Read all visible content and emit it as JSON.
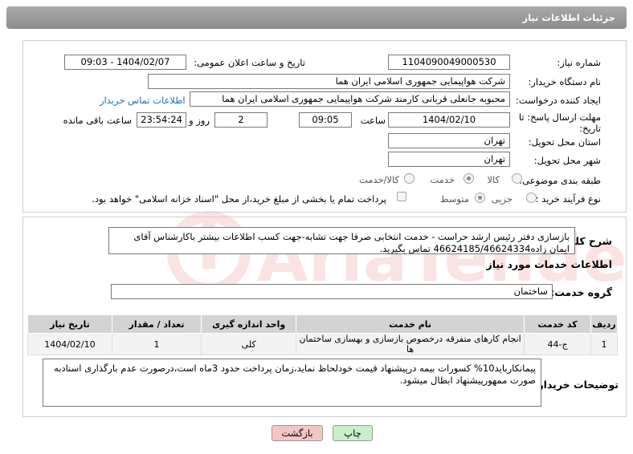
{
  "header": {
    "title": "جزئیات اطلاعات نیاز"
  },
  "form": {
    "need_number_label": "شماره نیاز:",
    "need_number": "1104090049000530",
    "announce_label": "تاریخ و ساعت اعلان عمومی:",
    "announce_value": "1404/02/07 - 09:03",
    "buyer_org_label": "نام دستگاه خریدار:",
    "buyer_org": "شرکت هواپیمایی جمهوری اسلامی ایران هما",
    "creator_label": "ایجاد کننده درخواست:",
    "creator": "محبوبه جانعلی قربانی کارمند شرکت هواپیمایی جمهوری اسلامی ایران هما",
    "contact_link": "اطلاعات تماس خریدار",
    "deadline_label_1": "مهلت ارسال پاسخ: تا",
    "deadline_label_2": "تاریخ:",
    "deadline_date": "1404/02/10",
    "time_label": "ساعت",
    "deadline_time": "09:05",
    "days_value": "2",
    "days_label": "روز و",
    "remaining_time": "23:54:24",
    "remaining_label": "ساعت باقی مانده",
    "province_label": "استان محل تحویل:",
    "province": "تهران",
    "city_label": "شهر محل تحویل:",
    "city": "تهران",
    "category_label": "طبقه بندی موضوعی:",
    "category_options": [
      "کالا",
      "خدمت",
      "کالا/خدمت"
    ],
    "category_selected": "خدمت",
    "process_label": "نوع فرآیند خرید :",
    "process_options": [
      "جزیی",
      "متوسط"
    ],
    "process_selected": "متوسط",
    "payment_note": "پرداخت تمام یا بخشی از مبلغ خرید،از محل \"اسناد خزانه اسلامی\" خواهد بود."
  },
  "description": {
    "label": "شرح کلی نیاز:",
    "text": "بازسازی دفتر رئیس ارشد حراست - خدمت انتخابی صرفا جهت تشابه-جهت کسب اطلاعات بیشتر باکارشناس آقای ایمان زاده46624185/46624334 تماس بگیرید."
  },
  "services": {
    "section_title": "اطلاعات خدمات مورد نیاز",
    "group_label": "گروه خدمت:",
    "group_value": "ساختمان",
    "columns": [
      "ردیف",
      "کد خدمت",
      "نام خدمت",
      "واحد اندازه گیری",
      "تعداد / مقدار",
      "تاریخ نیاز"
    ],
    "rows": [
      [
        "1",
        "ج-44",
        "انجام کارهای متفرقه درخصوص بازسازی و بهسازی ساختمان ها",
        "کلی",
        "1",
        "1404/02/10"
      ]
    ]
  },
  "buyer_notes": {
    "label": "توضیحات خریدار:",
    "text": "پیمانکارباید10% کسورات بیمه درپیشنهاد قیمت خودلحاظ نماید،زمان پرداخت حدود 3ماه است،درصورت عدم بارگذاری اسنادبه صورت ممهورپیشنهاد ابطال میشود."
  },
  "actions": {
    "print": "چاپ",
    "back": "بازگشت"
  },
  "watermark": {
    "text": "AriaTender.neT"
  }
}
